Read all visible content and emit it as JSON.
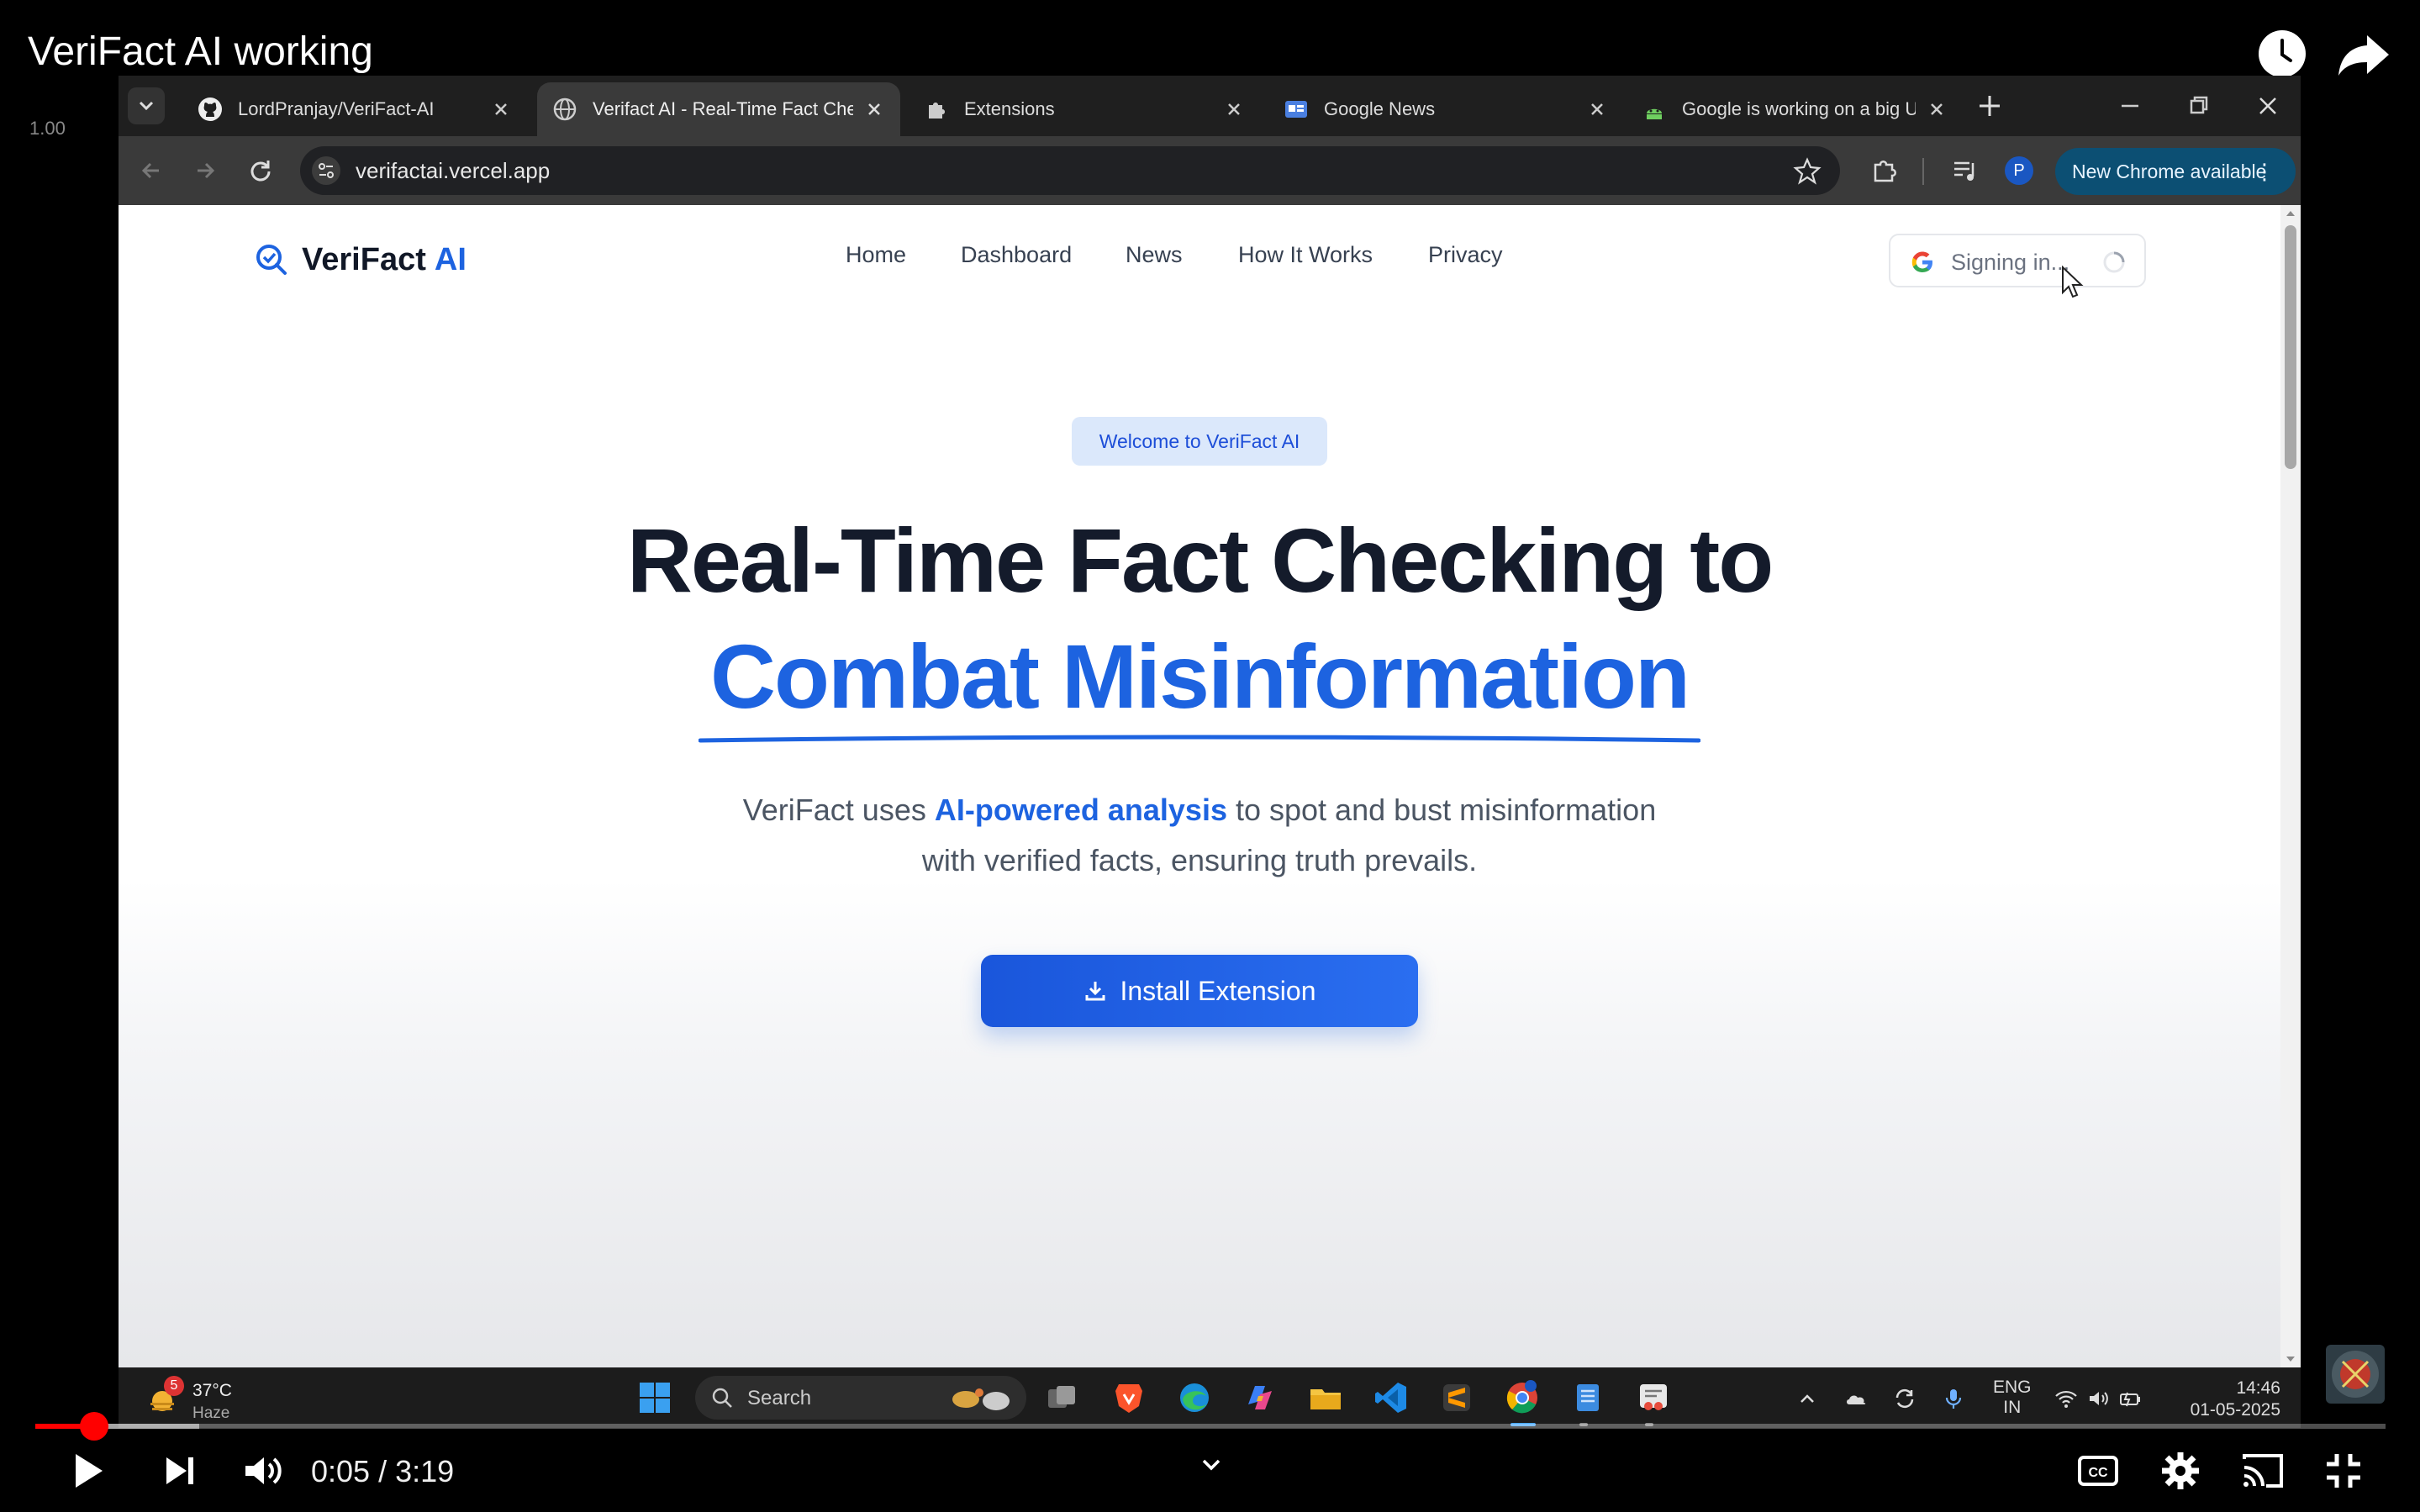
{
  "video": {
    "title": "VeriFact AI working",
    "speed": "1.00",
    "time": "0:05 / 3:19",
    "progress": 0.0252,
    "buffered": 0.0699
  },
  "browser": {
    "tabs": [
      {
        "label": "LordPranjay/VeriFact-AI",
        "icon": "github-icon",
        "active": false
      },
      {
        "label": "Verifact AI - Real-Time Fact Che",
        "icon": "globe-icon",
        "active": true
      },
      {
        "label": "Extensions",
        "icon": "puzzle-icon",
        "active": false
      },
      {
        "label": "Google News",
        "icon": "google-news-icon",
        "active": false
      },
      {
        "label": "Google is working on a big UI c",
        "icon": "android-icon",
        "active": false
      }
    ],
    "url": "verifactai.vercel.app",
    "profile_initial": "P",
    "update_label": "New Chrome available"
  },
  "site": {
    "logo": {
      "name": "VeriFact",
      "accent": "AI"
    },
    "nav": [
      "Home",
      "Dashboard",
      "News",
      "How It Works",
      "Privacy"
    ],
    "signin_label": "Signing in...",
    "badge": "Welcome to VeriFact AI",
    "hero_line1": "Real-Time Fact Checking to",
    "hero_line2": "Combat Misinformation",
    "subtitle_pre": "VeriFact uses ",
    "subtitle_highlight": "AI-powered analysis",
    "subtitle_post": " to spot and bust misinformation",
    "subtitle_line2": "with verified facts, ensuring truth prevails.",
    "cta": "Install Extension",
    "colors": {
      "accent": "#1d63e0",
      "heading": "#141b2b",
      "badge_bg": "#dbe8fb"
    }
  },
  "taskbar": {
    "weather_badge": "5",
    "temperature": "37°C",
    "weather": "Haze",
    "search_label": "Search",
    "lang_line1": "ENG",
    "lang_line2": "IN",
    "time": "14:46",
    "date": "01-05-2025"
  }
}
